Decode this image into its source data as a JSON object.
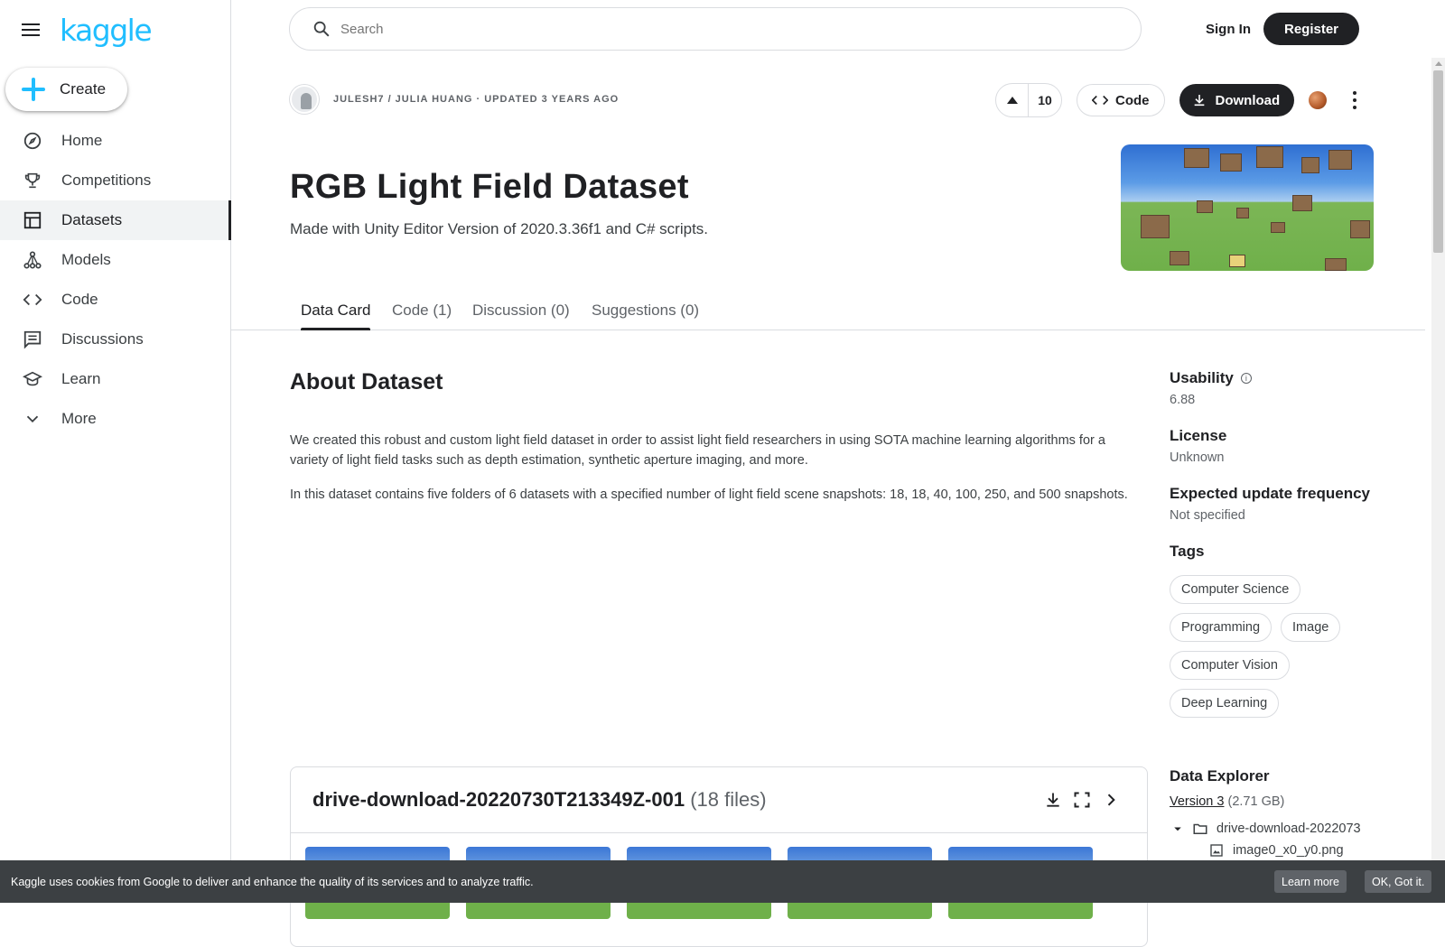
{
  "brand": {
    "logo_text": "kaggle",
    "accent": "#20beff"
  },
  "sidebar": {
    "create_label": "Create",
    "items": [
      {
        "label": "Home",
        "icon": "compass-icon"
      },
      {
        "label": "Competitions",
        "icon": "trophy-icon"
      },
      {
        "label": "Datasets",
        "icon": "table-icon",
        "active": true
      },
      {
        "label": "Models",
        "icon": "models-icon"
      },
      {
        "label": "Code",
        "icon": "code-icon"
      },
      {
        "label": "Discussions",
        "icon": "comments-icon"
      },
      {
        "label": "Learn",
        "icon": "school-icon"
      },
      {
        "label": "More",
        "icon": "chevron-down-icon"
      }
    ]
  },
  "header": {
    "search_placeholder": "Search",
    "sign_in": "Sign In",
    "register": "Register"
  },
  "dataset": {
    "owner_line": "JULESH7 / JULIA HUANG · UPDATED 3 YEARS AGO",
    "vote_count": "10",
    "code_label": "Code",
    "download_label": "Download",
    "title": "RGB Light Field Dataset",
    "subtitle": "Made with Unity Editor Version of 2020.3.36f1 and C# scripts."
  },
  "tabs": [
    {
      "label": "Data Card",
      "active": true
    },
    {
      "label": "Code (1)"
    },
    {
      "label": "Discussion (0)"
    },
    {
      "label": "Suggestions (0)"
    }
  ],
  "about": {
    "heading": "About Dataset",
    "p1": "We created this robust and custom light field dataset in order to assist light field researchers in using SOTA machine learning algorithms for a variety of light field tasks such as depth estimation, synthetic aperture imaging, and more.",
    "p2": "In this dataset contains five folders of 6 datasets with a specified number of light field scene snapshots: 18, 18, 40, 100, 250, and 500 snapshots."
  },
  "meta": {
    "usability_label": "Usability",
    "usability_value": "6.88",
    "license_label": "License",
    "license_value": "Unknown",
    "freq_label": "Expected update frequency",
    "freq_value": "Not specified",
    "tags_label": "Tags",
    "tags": [
      "Computer Science",
      "Programming",
      "Image",
      "Computer Vision",
      "Deep Learning"
    ]
  },
  "filecard": {
    "name": "drive-download-20220730T213349Z-001",
    "count": "(18 files)"
  },
  "explorer": {
    "heading": "Data Explorer",
    "version_link": "Version 3",
    "version_size": "(2.71 GB)",
    "folder": "drive-download-2022073",
    "file": "image0_x0_y0.png"
  },
  "cookie": {
    "message": "Kaggle uses cookies from Google to deliver and enhance the quality of its services and to analyze traffic.",
    "learn_more": "Learn more",
    "ok": "OK, Got it."
  }
}
